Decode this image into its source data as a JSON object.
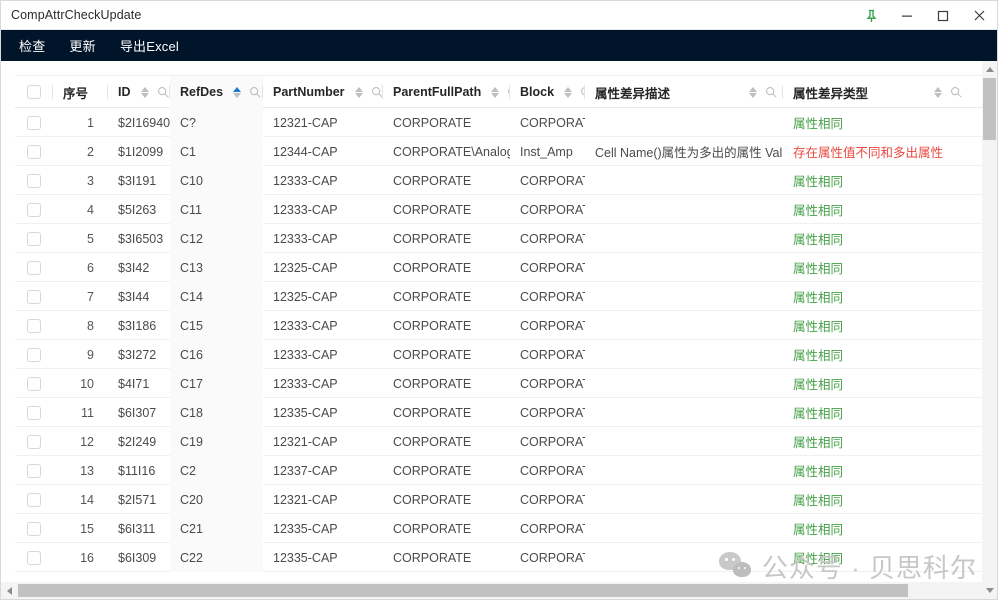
{
  "window": {
    "title": "CompAttrCheckUpdate",
    "controls": [
      {
        "name": "pin-icon",
        "glyph": "pin"
      },
      {
        "name": "minimize-button",
        "glyph": "minimize"
      },
      {
        "name": "maximize-button",
        "glyph": "maximize"
      },
      {
        "name": "close-button",
        "glyph": "close"
      }
    ]
  },
  "menubar": {
    "items": [
      {
        "label": "检查"
      },
      {
        "label": "更新"
      },
      {
        "label": "导出Excel"
      }
    ],
    "background": "#001529"
  },
  "table": {
    "columns": [
      {
        "key": "checkbox",
        "label": "",
        "sortable": false,
        "searchable": false,
        "sorted": false
      },
      {
        "key": "seq",
        "label": "序号",
        "sortable": false,
        "searchable": false,
        "sorted": false
      },
      {
        "key": "id",
        "label": "ID",
        "sortable": true,
        "searchable": true,
        "sorted": false
      },
      {
        "key": "refdes",
        "label": "RefDes",
        "sortable": true,
        "searchable": true,
        "sorted": true
      },
      {
        "key": "partnum",
        "label": "PartNumber",
        "sortable": true,
        "searchable": true,
        "sorted": false
      },
      {
        "key": "parent",
        "label": "ParentFullPath",
        "sortable": true,
        "searchable": true,
        "sorted": false
      },
      {
        "key": "block",
        "label": "Block",
        "sortable": true,
        "searchable": true,
        "sorted": false
      },
      {
        "key": "desc",
        "label": "属性差异描述",
        "sortable": true,
        "searchable": true,
        "sorted": false
      },
      {
        "key": "type",
        "label": "属性差异类型",
        "sortable": true,
        "searchable": true,
        "sorted": false
      }
    ],
    "rows": [
      {
        "seq": "1",
        "id": "$2I16940",
        "refdes": "C?",
        "partnum": "12321-CAP",
        "parent": "CORPORATE",
        "block": "CORPORATE",
        "desc": "",
        "type": "属性相同",
        "type_color": "green"
      },
      {
        "seq": "2",
        "id": "$1I2099",
        "refdes": "C1",
        "partnum": "12344-CAP",
        "parent": "CORPORATE\\Analog_...",
        "block": "Inst_Amp",
        "desc": "Cell Name()属性为多出的属性 Val...",
        "type": "存在属性值不同和多出属性",
        "type_color": "red"
      },
      {
        "seq": "3",
        "id": "$3I191",
        "refdes": "C10",
        "partnum": "12333-CAP",
        "parent": "CORPORATE",
        "block": "CORPORATE",
        "desc": "",
        "type": "属性相同",
        "type_color": "green"
      },
      {
        "seq": "4",
        "id": "$5I263",
        "refdes": "C11",
        "partnum": "12333-CAP",
        "parent": "CORPORATE",
        "block": "CORPORATE",
        "desc": "",
        "type": "属性相同",
        "type_color": "green"
      },
      {
        "seq": "5",
        "id": "$3I6503",
        "refdes": "C12",
        "partnum": "12333-CAP",
        "parent": "CORPORATE",
        "block": "CORPORATE",
        "desc": "",
        "type": "属性相同",
        "type_color": "green"
      },
      {
        "seq": "6",
        "id": "$3I42",
        "refdes": "C13",
        "partnum": "12325-CAP",
        "parent": "CORPORATE",
        "block": "CORPORATE",
        "desc": "",
        "type": "属性相同",
        "type_color": "green"
      },
      {
        "seq": "7",
        "id": "$3I44",
        "refdes": "C14",
        "partnum": "12325-CAP",
        "parent": "CORPORATE",
        "block": "CORPORATE",
        "desc": "",
        "type": "属性相同",
        "type_color": "green"
      },
      {
        "seq": "8",
        "id": "$3I186",
        "refdes": "C15",
        "partnum": "12333-CAP",
        "parent": "CORPORATE",
        "block": "CORPORATE",
        "desc": "",
        "type": "属性相同",
        "type_color": "green"
      },
      {
        "seq": "9",
        "id": "$3I272",
        "refdes": "C16",
        "partnum": "12333-CAP",
        "parent": "CORPORATE",
        "block": "CORPORATE",
        "desc": "",
        "type": "属性相同",
        "type_color": "green"
      },
      {
        "seq": "10",
        "id": "$4I71",
        "refdes": "C17",
        "partnum": "12333-CAP",
        "parent": "CORPORATE",
        "block": "CORPORATE",
        "desc": "",
        "type": "属性相同",
        "type_color": "green"
      },
      {
        "seq": "11",
        "id": "$6I307",
        "refdes": "C18",
        "partnum": "12335-CAP",
        "parent": "CORPORATE",
        "block": "CORPORATE",
        "desc": "",
        "type": "属性相同",
        "type_color": "green"
      },
      {
        "seq": "12",
        "id": "$2I249",
        "refdes": "C19",
        "partnum": "12321-CAP",
        "parent": "CORPORATE",
        "block": "CORPORATE",
        "desc": "",
        "type": "属性相同",
        "type_color": "green"
      },
      {
        "seq": "13",
        "id": "$11I16",
        "refdes": "C2",
        "partnum": "12337-CAP",
        "parent": "CORPORATE",
        "block": "CORPORATE",
        "desc": "",
        "type": "属性相同",
        "type_color": "green"
      },
      {
        "seq": "14",
        "id": "$2I571",
        "refdes": "C20",
        "partnum": "12321-CAP",
        "parent": "CORPORATE",
        "block": "CORPORATE",
        "desc": "",
        "type": "属性相同",
        "type_color": "green"
      },
      {
        "seq": "15",
        "id": "$6I311",
        "refdes": "C21",
        "partnum": "12335-CAP",
        "parent": "CORPORATE",
        "block": "CORPORATE",
        "desc": "",
        "type": "属性相同",
        "type_color": "green"
      },
      {
        "seq": "16",
        "id": "$6I309",
        "refdes": "C22",
        "partnum": "12335-CAP",
        "parent": "CORPORATE",
        "block": "CORPORATE",
        "desc": "",
        "type": "属性相同",
        "type_color": "green"
      }
    ]
  },
  "watermark": {
    "text": "公众号 · 贝思科尔",
    "icon": "wechat-icon"
  },
  "colors": {
    "menu_bg": "#001529",
    "sorted_column_bg": "#fafafa",
    "status_same": "#44a047",
    "status_diff": "#e8493f",
    "sort_active": "#1677d9",
    "pin_green": "#2d9e44"
  }
}
